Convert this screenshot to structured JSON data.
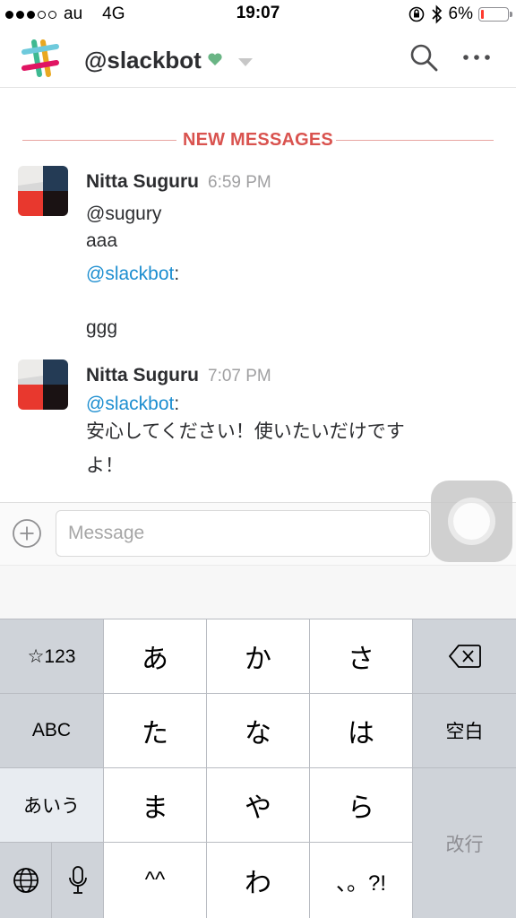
{
  "status_bar": {
    "carrier": "au",
    "network": "4G",
    "time": "19:07",
    "battery": "6%",
    "signal_bars": 3,
    "battery_level": 0.06
  },
  "header": {
    "title": "@slackbot",
    "icons": [
      "slack-logo",
      "heart-icon",
      "chevron-down-icon",
      "search-icon",
      "more-icon"
    ],
    "presence_color": "#6ab585"
  },
  "divider": {
    "label": "NEW MESSAGES",
    "color": "#d9534f"
  },
  "messages": [
    {
      "author": "Nitta Suguru",
      "time": "6:59 PM",
      "lines": [
        "@sugury",
        "aaa"
      ],
      "mention": "@slackbot",
      "after_mention": ":",
      "tail": "ggg"
    },
    {
      "author": "Nitta Suguru",
      "time": "7:07 PM",
      "mention": "@slackbot",
      "after_mention": ":",
      "lines": [
        "安心してください！使いたいだけです",
        "よ！"
      ]
    }
  ],
  "composer": {
    "placeholder": "Message",
    "value": ""
  },
  "keyboard": {
    "left": [
      "☆123",
      "ABC",
      "あいう"
    ],
    "rows": [
      [
        "あ",
        "か",
        "さ"
      ],
      [
        "た",
        "な",
        "は"
      ],
      [
        "ま",
        "や",
        "ら"
      ],
      [
        "^^",
        "わ",
        "、。?!"
      ]
    ],
    "space": "空白",
    "enter": "改行",
    "icons": [
      "backspace-icon",
      "globe-icon",
      "microphone-icon"
    ]
  }
}
